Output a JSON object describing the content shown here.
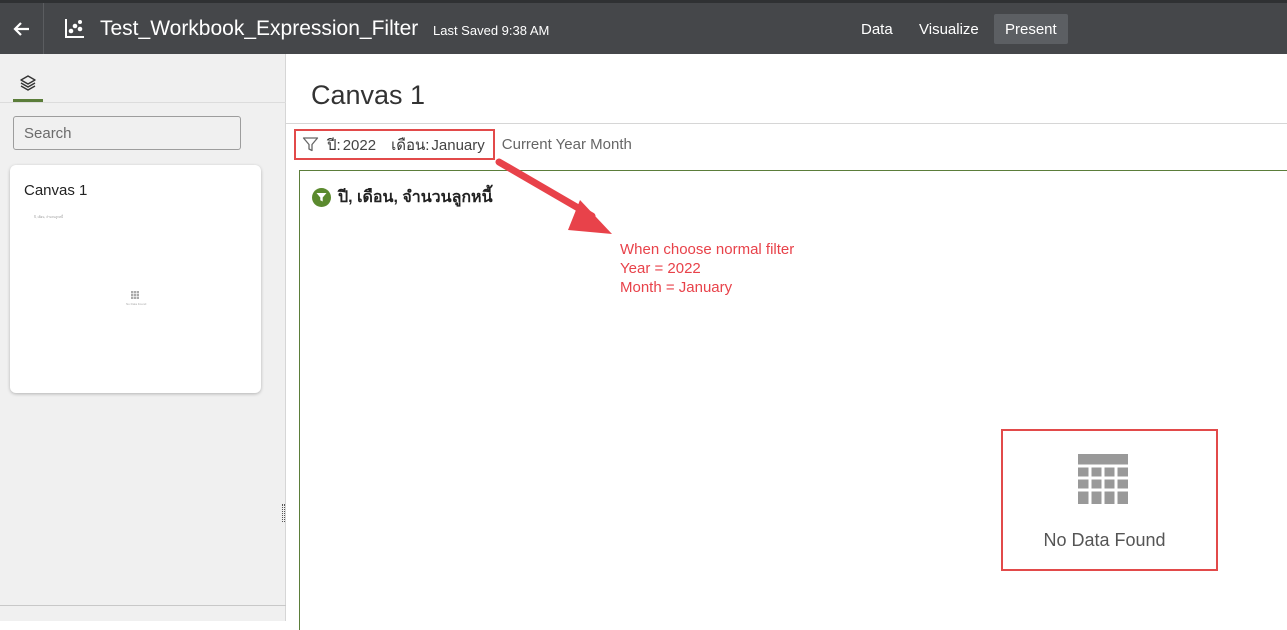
{
  "topbar": {
    "title": "Test_Workbook_Expression_Filter",
    "last_saved": "Last Saved 9:38 AM",
    "nav": [
      "Data",
      "Visualize",
      "Present"
    ],
    "active_nav": "Present"
  },
  "sidebar": {
    "search_placeholder": "Search",
    "canvases": [
      {
        "label": "Canvas 1",
        "thumb_title": "ปี, เดือน, จำนวนลูกหนี้",
        "thumb_nodata": "No Data Found"
      }
    ]
  },
  "main": {
    "canvas_title": "Canvas 1",
    "filters": [
      {
        "label": "ปี:",
        "value": "2022"
      },
      {
        "label": "เดือน:",
        "value": "January"
      }
    ],
    "filter_extra": "Current Year Month",
    "viz_title": "ปี, เดือน, จำนวนลูกหนี้",
    "no_data": "No Data Found"
  },
  "annotation": {
    "lines": [
      "When choose normal filter",
      "Year = 2022",
      "Month = January"
    ],
    "color": "#e8424a"
  },
  "colors": {
    "topbar_bg": "#45474a",
    "accent_green": "#5b7d3a",
    "highlight_red": "#e24a4a"
  }
}
